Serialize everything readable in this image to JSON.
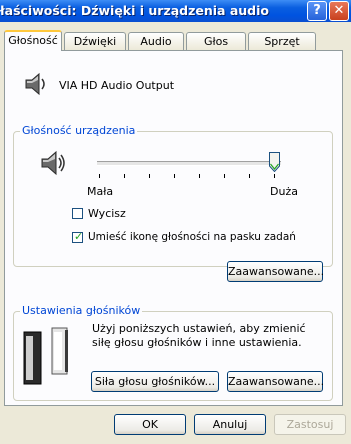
{
  "window": {
    "title": "łaściwości: Dźwięki i urządzenia audio",
    "help_glyph": "?",
    "close_glyph": "✕"
  },
  "tabs": [
    {
      "label": "Głośność",
      "active": true
    },
    {
      "label": "Dźwięki",
      "active": false
    },
    {
      "label": "Audio",
      "active": false
    },
    {
      "label": "Głos",
      "active": false
    },
    {
      "label": "Sprzęt",
      "active": false
    }
  ],
  "device": {
    "name": "VIA HD Audio Output",
    "icon": "speaker-icon"
  },
  "volume_group": {
    "title": "Głośność urządzenia",
    "slider_min_label": "Mała",
    "slider_max_label": "Duża",
    "slider_value": 1.0,
    "mute_label": "Wycisz",
    "mute_checked": false,
    "tray_label": "Umieść ikonę głośności na pasku zadań",
    "tray_checked": true,
    "advanced_button": "Zaawansowane..."
  },
  "speakers_group": {
    "title": "Ustawienia głośników",
    "description": "Użyj poniższych ustawień, aby zmienić siłę głosu głośników i inne ustawienia.",
    "volume_button": "Siła głosu głośników...",
    "advanced_button": "Zaawansowane..."
  },
  "footer": {
    "ok": "OK",
    "cancel": "Anuluj",
    "apply": "Zastosuj"
  },
  "colors": {
    "titlebar": "#0053e0",
    "group_title": "#0046d5",
    "active_tab_highlight": "#ffc83c"
  }
}
